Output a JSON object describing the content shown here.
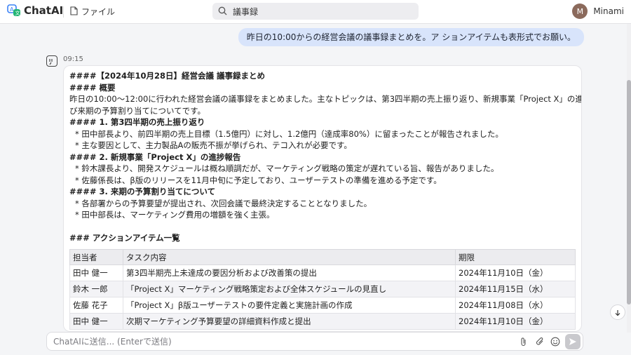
{
  "app": {
    "name": "ChatAI"
  },
  "menu": {
    "file_label": "ファイル"
  },
  "search": {
    "query": "議事録"
  },
  "user": {
    "initial": "M",
    "name": "Minami"
  },
  "conversation": {
    "user_message": "昨日の10:00からの経営会議の議事録まとめを。ア ションアイテムも表形式でお願い。",
    "assistant_time": "09:15",
    "lines": {
      "l1": "####【2024年10月28日】経営会議 議事録まとめ",
      "l2": "#### 概要",
      "l3": "昨日の10:00〜12:00に行われた経営会議の議事録をまとめました。主なトピックは、第3四半期の売上振り返り、新規事業「Project X」の進捗報告、およ",
      "l4": "び来期の予算割り当てについてです。",
      "l5": "#### 1. 第3四半期の売上振り返り",
      "l6": "* 田中部長より、前四半期の売上目標（1.5億円）に対し、1.2億円（達成率80%）に留まったことが報告されました。",
      "l7": "* 主な要因として、主力製品Aの販売不振が挙げられ、テコ入れが必要です。",
      "l8": "#### 2. 新規事業「Project X」の進捗報告",
      "l9": "* 鈴木課長より、開発スケジュールは概ね順調だが、マーケティング戦略の策定が遅れている旨、報告がありました。",
      "l10": "* 佐藤係長は、β版のリリースを11月中旬に予定しており、ユーザーテストの準備を進める予定です。",
      "l11": "#### 3. 来期の予算割り当てについて",
      "l12": "* 各部署からの予算要望が提出され、次回会議で最終決定することとなりました。",
      "l13": "* 田中部長は、マーケティング費用の増額を強く主張。",
      "l14": "### アクションアイテム一覧"
    },
    "table": {
      "headers": [
        "担当者",
        "タスク内容",
        "期限"
      ],
      "rows": [
        [
          "田中 健一",
          "第3四半期売上未達成の要因分析および改善策の提出",
          "2024年11月10日（金）"
        ],
        [
          "鈴木 一郎",
          "「Project X」マーケティング戦略策定および全体スケジュールの見直し",
          "2024年11月15日（水）"
        ],
        [
          "佐藤 花子",
          "「Project X」β版ユーザーテストの要件定義と実施計画の作成",
          "2024年11月08日（水）"
        ],
        [
          "田中 健一",
          "次期マーケティング予算要望の詳細資料作成と提出",
          "2024年11月10日（金）"
        ]
      ]
    }
  },
  "composer": {
    "placeholder": "ChatAIに送信... (Enterで送信)"
  },
  "icons": {
    "logo": "chatai-logo-icon",
    "file": "document-icon",
    "search": "search-icon",
    "bot": "assistant-icon",
    "scroll_down": "arrow-down-icon",
    "attach": "paperclip-icon",
    "clip": "attachment-icon",
    "emoji": "smiley-icon",
    "send": "send-icon"
  },
  "colors": {
    "user_bubble": "#d8e4fb",
    "logo_blue": "#3b82f6",
    "logo_green": "#22b573"
  }
}
